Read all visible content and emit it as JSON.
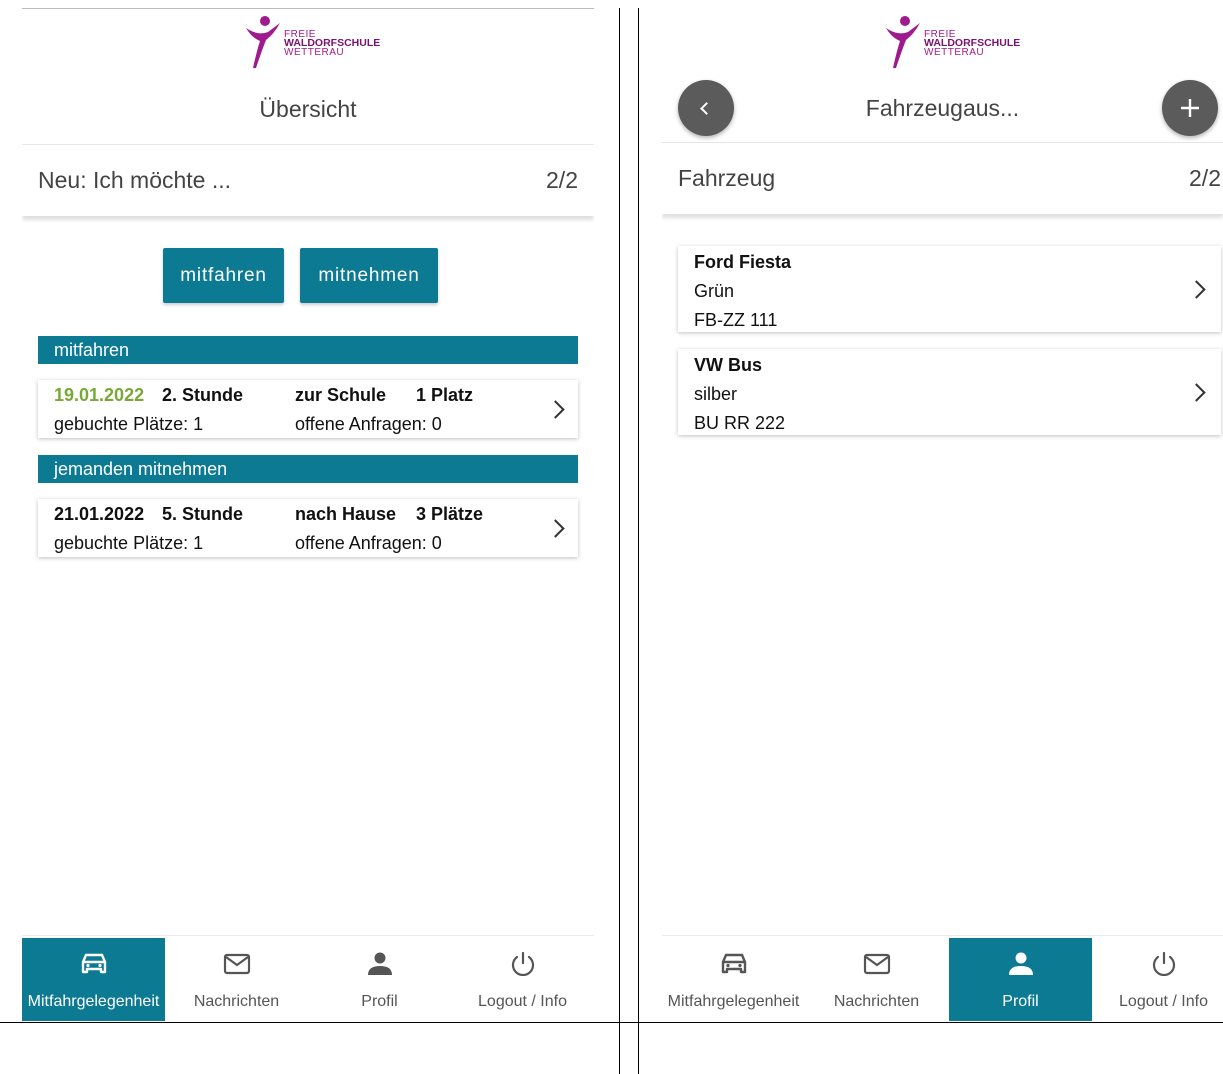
{
  "brand": {
    "logo_line1": "FREIE",
    "logo_line2": "WALDORFSCHULE",
    "logo_line3": "WETTERAU",
    "primary_color": "#0c7a93",
    "logo_color": "#a01a8f",
    "date_accent_color": "#7aa836"
  },
  "left_screen": {
    "title": "Übersicht",
    "section": {
      "title": "Neu: Ich möchte ...",
      "count": "2/2"
    },
    "buttons": {
      "mitfahren": "mitfahren",
      "mitnehmen": "mitnehmen"
    },
    "groups": [
      {
        "header": "mitfahren",
        "rides": [
          {
            "date": "19.01.2022",
            "lesson": "2. Stunde",
            "direction": "zur Schule",
            "seats": "1 Platz",
            "booked": "gebuchte Plätze: 1",
            "requests": "offene Anfragen: 0"
          }
        ]
      },
      {
        "header": "jemanden mitnehmen",
        "rides": [
          {
            "date": "21.01.2022",
            "lesson": "5. Stunde",
            "direction": "nach Hause",
            "seats": "3 Plätze",
            "booked": "gebuchte Plätze: 1",
            "requests": "offene Anfragen: 0"
          }
        ]
      }
    ],
    "active_nav": "Mitfahrgelegenheit"
  },
  "right_screen": {
    "title": "Fahrzeugaus...",
    "section": {
      "title": "Fahrzeug",
      "count": "2/2"
    },
    "vehicles": [
      {
        "name": "Ford Fiesta",
        "color": "Grün",
        "plate": "FB-ZZ 111"
      },
      {
        "name": "VW Bus",
        "color": "silber",
        "plate": "BU RR 222"
      }
    ],
    "active_nav": "Profil"
  },
  "nav": {
    "items": [
      {
        "label": "Mitfahrgelegenheit",
        "icon": "car-icon"
      },
      {
        "label": "Nachrichten",
        "icon": "mail-icon"
      },
      {
        "label": "Profil",
        "icon": "person-icon"
      },
      {
        "label": "Logout / Info",
        "icon": "power-icon"
      }
    ]
  }
}
